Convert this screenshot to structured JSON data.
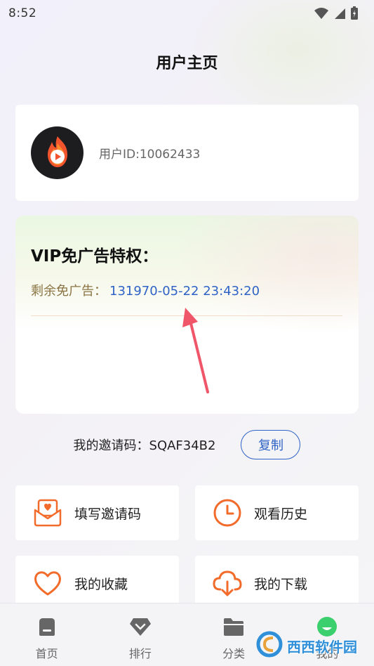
{
  "status_bar": {
    "time": "8:52"
  },
  "page_title": "用户主页",
  "profile": {
    "user_id_label": "用户ID:10062433"
  },
  "vip": {
    "title": "VIP免广告特权：",
    "remaining_label": "剩余免广告：",
    "remaining_value": "131970-05-22 23:43:20"
  },
  "invite": {
    "text": "我的邀请码：SQAF34B2",
    "copy_label": "复制"
  },
  "tiles": [
    {
      "label": "填写邀请码",
      "icon": "mail-heart-icon"
    },
    {
      "label": "观看历史",
      "icon": "clock-icon"
    },
    {
      "label": "我的收藏",
      "icon": "heart-icon"
    },
    {
      "label": "我的下载",
      "icon": "cloud-download-icon"
    }
  ],
  "bottom_nav": [
    {
      "label": "首页",
      "icon": "home-icon"
    },
    {
      "label": "排行",
      "icon": "diamond-icon"
    },
    {
      "label": "分类",
      "icon": "folder-icon"
    },
    {
      "label": "我的",
      "icon": "profile-icon"
    }
  ],
  "watermark": {
    "text": "西西软件园"
  },
  "colors": {
    "accent_blue": "#2f63c6",
    "gold_text": "#8a7443",
    "icon_orange": "#f26b2a",
    "nav_active_green": "#3ccf6e"
  }
}
